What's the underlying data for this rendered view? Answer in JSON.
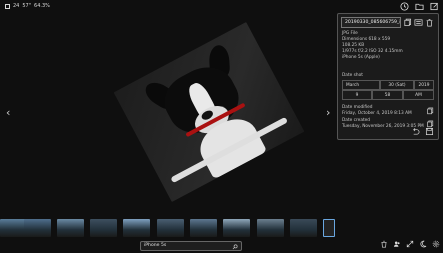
{
  "topbar": {
    "count": "24",
    "seconds": "57\"",
    "zoom": "64.3%"
  },
  "panel": {
    "filename": "20190330_085606759_iOS",
    "file_type": "JPG File",
    "dimensions": "Dimensions 618 x 559",
    "size": "108.25 KB",
    "exposure": "1/977s f/2.2 ISO 32 4.15mm",
    "camera": "iPhone 5s (Apple)",
    "date_shot_label": "Date shot",
    "date": {
      "month": "March",
      "day": "30 (Sat)",
      "year": "2019"
    },
    "time": {
      "hour": "9",
      "minute": "58",
      "ampm": "AM"
    },
    "modified_label": "Date modified",
    "modified_value": "Friday, October 4, 2019 8:13 AM",
    "created_label": "Date created",
    "created_value": "Tuesday, November 26, 2019 3:05 PM"
  },
  "nav": {
    "prev": "‹",
    "next": "›"
  },
  "search": {
    "value": "iPhone 5s"
  },
  "thumbnails": [
    {
      "color": "#5a7d9a"
    },
    {
      "color": "#4f6f8d"
    },
    {
      "color": "#6a8aa4"
    },
    {
      "color": "#3d4f5f"
    },
    {
      "color": "#7ea0c0"
    },
    {
      "color": "#4a5f72"
    },
    {
      "color": "#5d7790"
    },
    {
      "color": "#8fa7bb"
    },
    {
      "color": "#6b7f8f"
    },
    {
      "color": "#3a4a58"
    }
  ]
}
